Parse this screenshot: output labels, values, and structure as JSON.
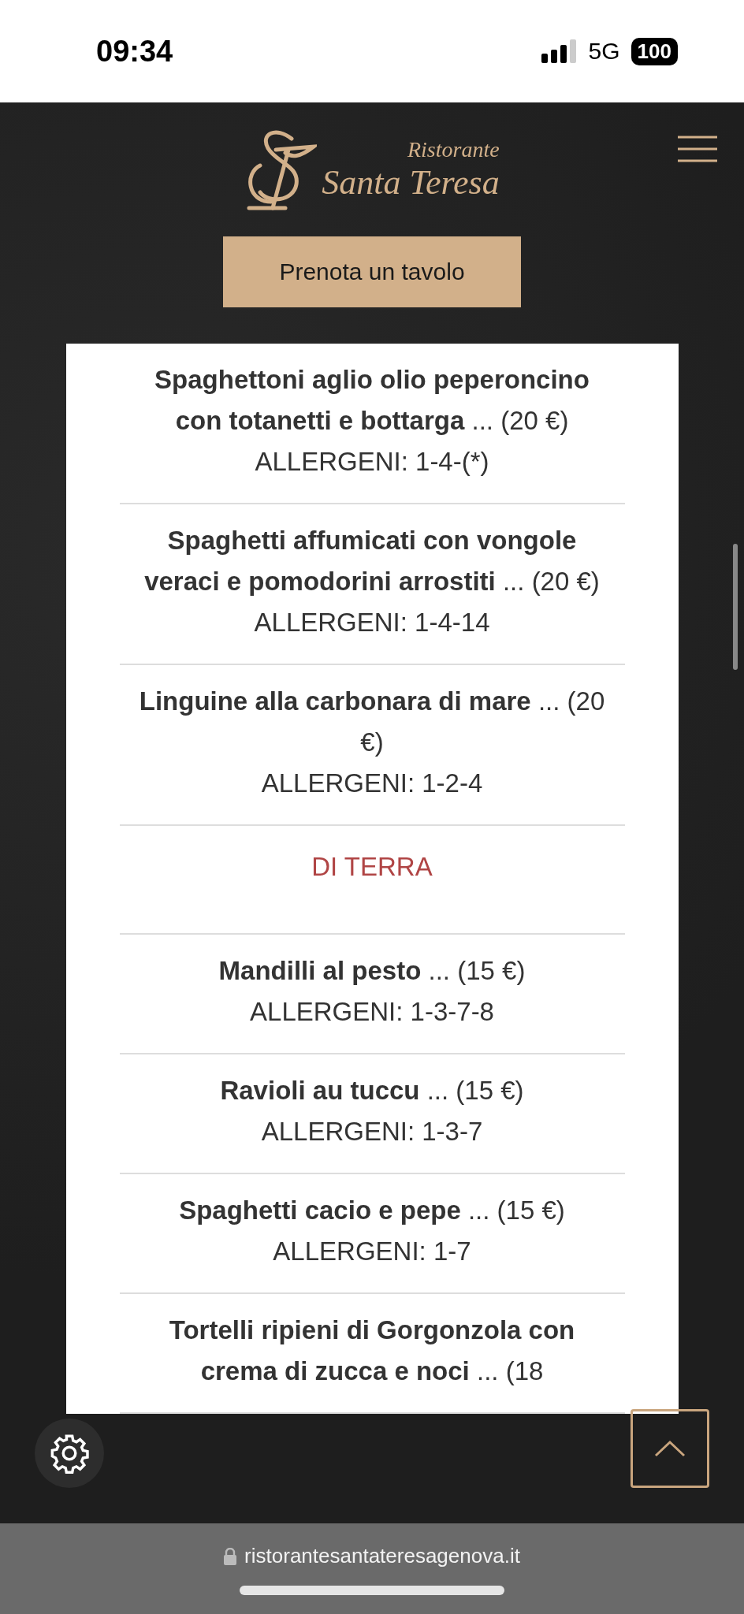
{
  "status_bar": {
    "time": "09:34",
    "network": "5G",
    "battery": "100"
  },
  "header": {
    "logo_line1": "Ristorante",
    "logo_line2": "Santa Teresa",
    "cta": "Prenota un tavolo"
  },
  "menu": [
    {
      "kind": "dish",
      "name": "Spaghettoni aglio olio peperoncino con totanetti e bottarga",
      "price": "... (20 €)",
      "allergens": "ALLERGENI: 1-4-(*)"
    },
    {
      "kind": "dish",
      "name": "Spaghetti affumicati con vongole veraci e pomodorini arrostiti",
      "price": "... (20 €)",
      "allergens": "ALLERGENI: 1-4-14"
    },
    {
      "kind": "dish",
      "name": "Linguine alla carbonara di mare",
      "price": "... (20 €)",
      "allergens": "ALLERGENI: 1-2-4"
    },
    {
      "kind": "heading",
      "name": "DI TERRA"
    },
    {
      "kind": "dish",
      "name": "Mandilli al pesto",
      "price": "... (15 €)",
      "allergens": "ALLERGENI: 1-3-7-8"
    },
    {
      "kind": "dish",
      "name": "Ravioli au tuccu",
      "price": "... (15 €)",
      "allergens": "ALLERGENI: 1-3-7"
    },
    {
      "kind": "dish",
      "name": "Spaghetti cacio e pepe",
      "price": "... (15 €)",
      "allergens": "ALLERGENI: 1-7"
    },
    {
      "kind": "dish",
      "name": "Tortelli ripieni di Gorgonzola con crema di zucca e noci",
      "price": "... (18"
    }
  ],
  "browser_bar": {
    "url": "ristorantesantateresagenova.it"
  }
}
